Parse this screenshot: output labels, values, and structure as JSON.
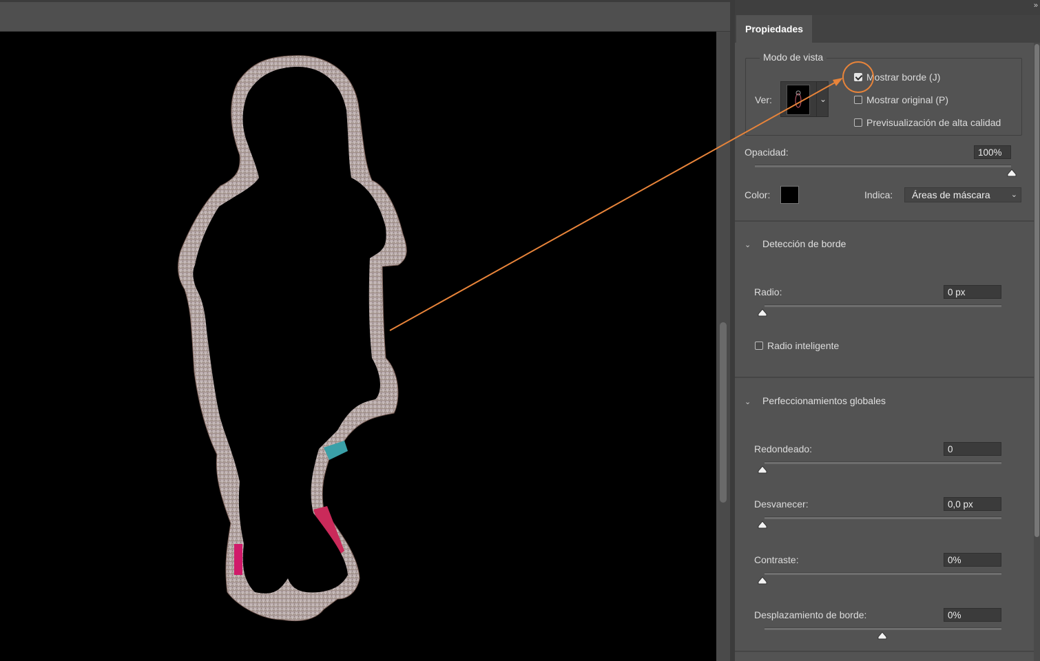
{
  "canvas": {
    "background": "#000000",
    "image_description_icon": "child-silhouette-border"
  },
  "panel": {
    "tab_label": "Propiedades",
    "collapse_icon": "»",
    "view_mode": {
      "legend": "Modo de vista",
      "ver_label": "Ver:",
      "show_border_label": "Mostrar borde (J)",
      "show_border_checked": true,
      "show_original_label": "Mostrar original (P)",
      "show_original_checked": false,
      "hq_preview_label": "Previsualización de alta calidad",
      "hq_preview_checked": false
    },
    "opacity": {
      "label": "Opacidad:",
      "value": "100%",
      "fraction": 1.0
    },
    "color": {
      "label": "Color:",
      "swatch": "#000000"
    },
    "indica": {
      "label": "Indica:",
      "value": "Áreas de máscara"
    },
    "edge_detection": {
      "title": "Detección de borde",
      "radius_label": "Radio:",
      "radius_value": "0 px",
      "radius_fraction": 0.0,
      "smart_radius_label": "Radio inteligente",
      "smart_radius_checked": false
    },
    "global_refinements": {
      "title": "Perfeccionamientos globales",
      "smooth_label": "Redondeado:",
      "smooth_value": "0",
      "smooth_fraction": 0.0,
      "feather_label": "Desvanecer:",
      "feather_value": "0,0 px",
      "feather_fraction": 0.0,
      "contrast_label": "Contraste:",
      "contrast_value": "0%",
      "contrast_fraction": 0.0,
      "shift_label": "Desplazamiento de borde:",
      "shift_value": "0%",
      "shift_fraction": 0.5
    }
  },
  "annotation": {
    "color": "#e8843a"
  }
}
